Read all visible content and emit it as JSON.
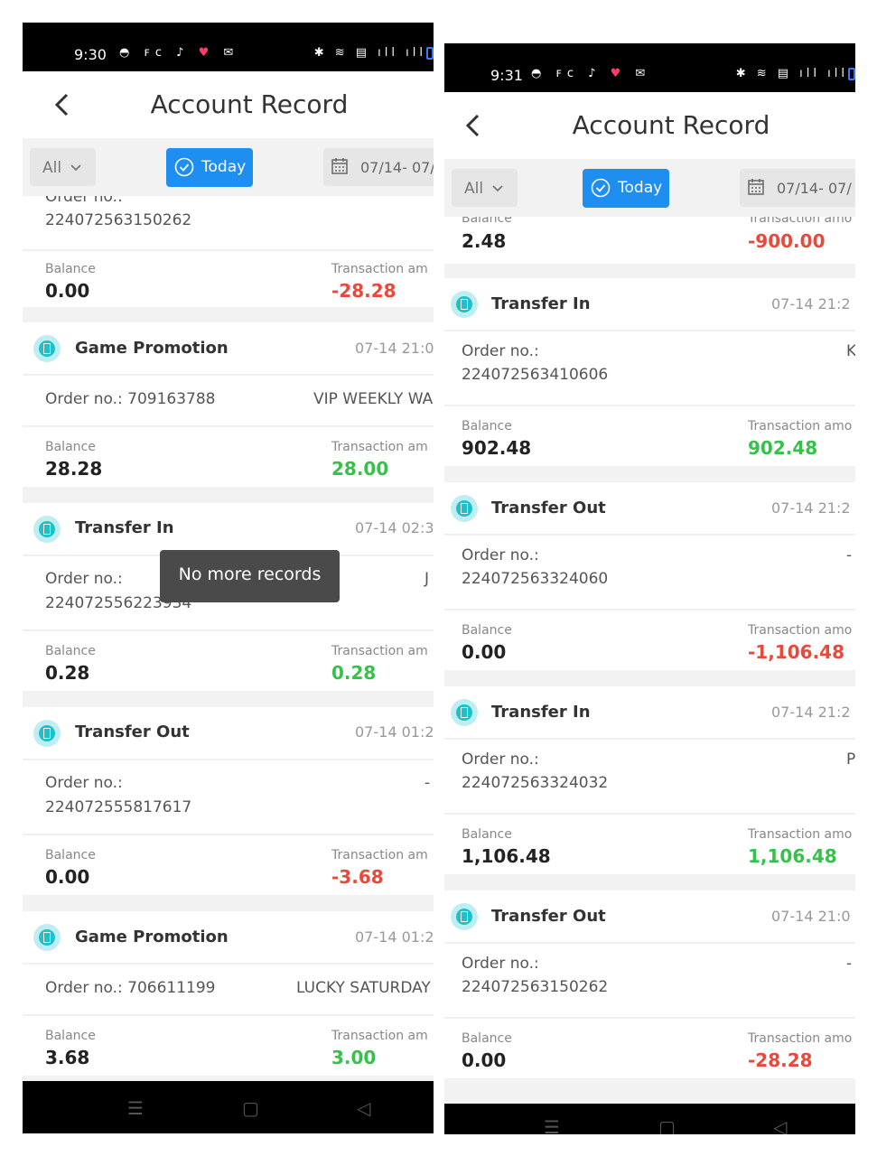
{
  "left": {
    "status": {
      "time": "9:30"
    },
    "header": {
      "title": "Account Record"
    },
    "filters": {
      "all": "All",
      "today": "Today",
      "date": "07/14- 07/"
    },
    "partial_order": {
      "label": "Order no.:",
      "number": "224072563150262"
    },
    "partial_balance": {
      "balance_label": "Balance",
      "balance": "0.00",
      "amount_label": "Transaction am",
      "amount": "-28.28"
    },
    "records": [
      {
        "title": "Game Promotion",
        "time": "07-14 21:0",
        "order_inline": "Order no.: 709163788",
        "remark": "VIP WEEKLY WA",
        "balance_label": "Balance",
        "balance": "28.28",
        "amount_label": "Transaction am",
        "amount": "28.00"
      },
      {
        "title": "Transfer In",
        "time": "07-14 02:3",
        "order_label": "Order no.:",
        "order_no": "224072556223934",
        "side_char": "J",
        "balance_label": "Balance",
        "balance": "0.28",
        "amount_label": "Transaction am",
        "amount": "0.28"
      },
      {
        "title": "Transfer Out",
        "time": "07-14 01:2",
        "order_label": "Order no.:",
        "order_no": "224072555817617",
        "side_char": "-",
        "balance_label": "Balance",
        "balance": "0.00",
        "amount_label": "Transaction am",
        "amount": "-3.68"
      },
      {
        "title": "Game Promotion",
        "time": "07-14 01:2",
        "order_inline": "Order no.: 706611199",
        "remark": "LUCKY SATURDAY",
        "balance_label": "Balance",
        "balance": "3.68",
        "amount_label": "Transaction am",
        "amount": "3.00"
      }
    ],
    "toast": "No more records"
  },
  "right": {
    "status": {
      "time": "9:31"
    },
    "header": {
      "title": "Account Record"
    },
    "filters": {
      "all": "All",
      "today": "Today",
      "date": "07/14- 07/"
    },
    "partial_top": {
      "balance_label": "Balance",
      "balance": "2.48",
      "amount_label": "Transaction amo",
      "amount": "-900.00"
    },
    "records": [
      {
        "title": "Transfer In",
        "time": "07-14 21:2",
        "order_label": "Order no.:",
        "order_no": "224072563410606",
        "side_char": "K",
        "balance_label": "Balance",
        "balance": "902.48",
        "amount_label": "Transaction amo",
        "amount": "902.48"
      },
      {
        "title": "Transfer Out",
        "time": "07-14 21:2",
        "order_label": "Order no.:",
        "order_no": "224072563324060",
        "side_char": "-",
        "balance_label": "Balance",
        "balance": "0.00",
        "amount_label": "Transaction amo",
        "amount": "-1,106.48"
      },
      {
        "title": "Transfer In",
        "time": "07-14 21:2",
        "order_label": "Order no.:",
        "order_no": "224072563324032",
        "side_char": "P",
        "balance_label": "Balance",
        "balance": "1,106.48",
        "amount_label": "Transaction amo",
        "amount": "1,106.48"
      },
      {
        "title": "Transfer Out",
        "time": "07-14 21:0",
        "order_label": "Order no.:",
        "order_no": "224072563150262",
        "side_char": "-",
        "balance_label": "Balance",
        "balance": "0.00",
        "amount_label": "Transaction amo",
        "amount": "-28.28"
      }
    ]
  },
  "icons": [
    "back-icon",
    "chevron-down-icon",
    "check-circle-icon",
    "calendar-icon",
    "record-icon",
    "menu-icon",
    "home-icon",
    "back-nav-icon"
  ],
  "colors": {
    "accent": "#1e8ef0",
    "negative": "#e8493b",
    "positive": "#36c24a",
    "icon_teal": "#1fc0c9"
  }
}
